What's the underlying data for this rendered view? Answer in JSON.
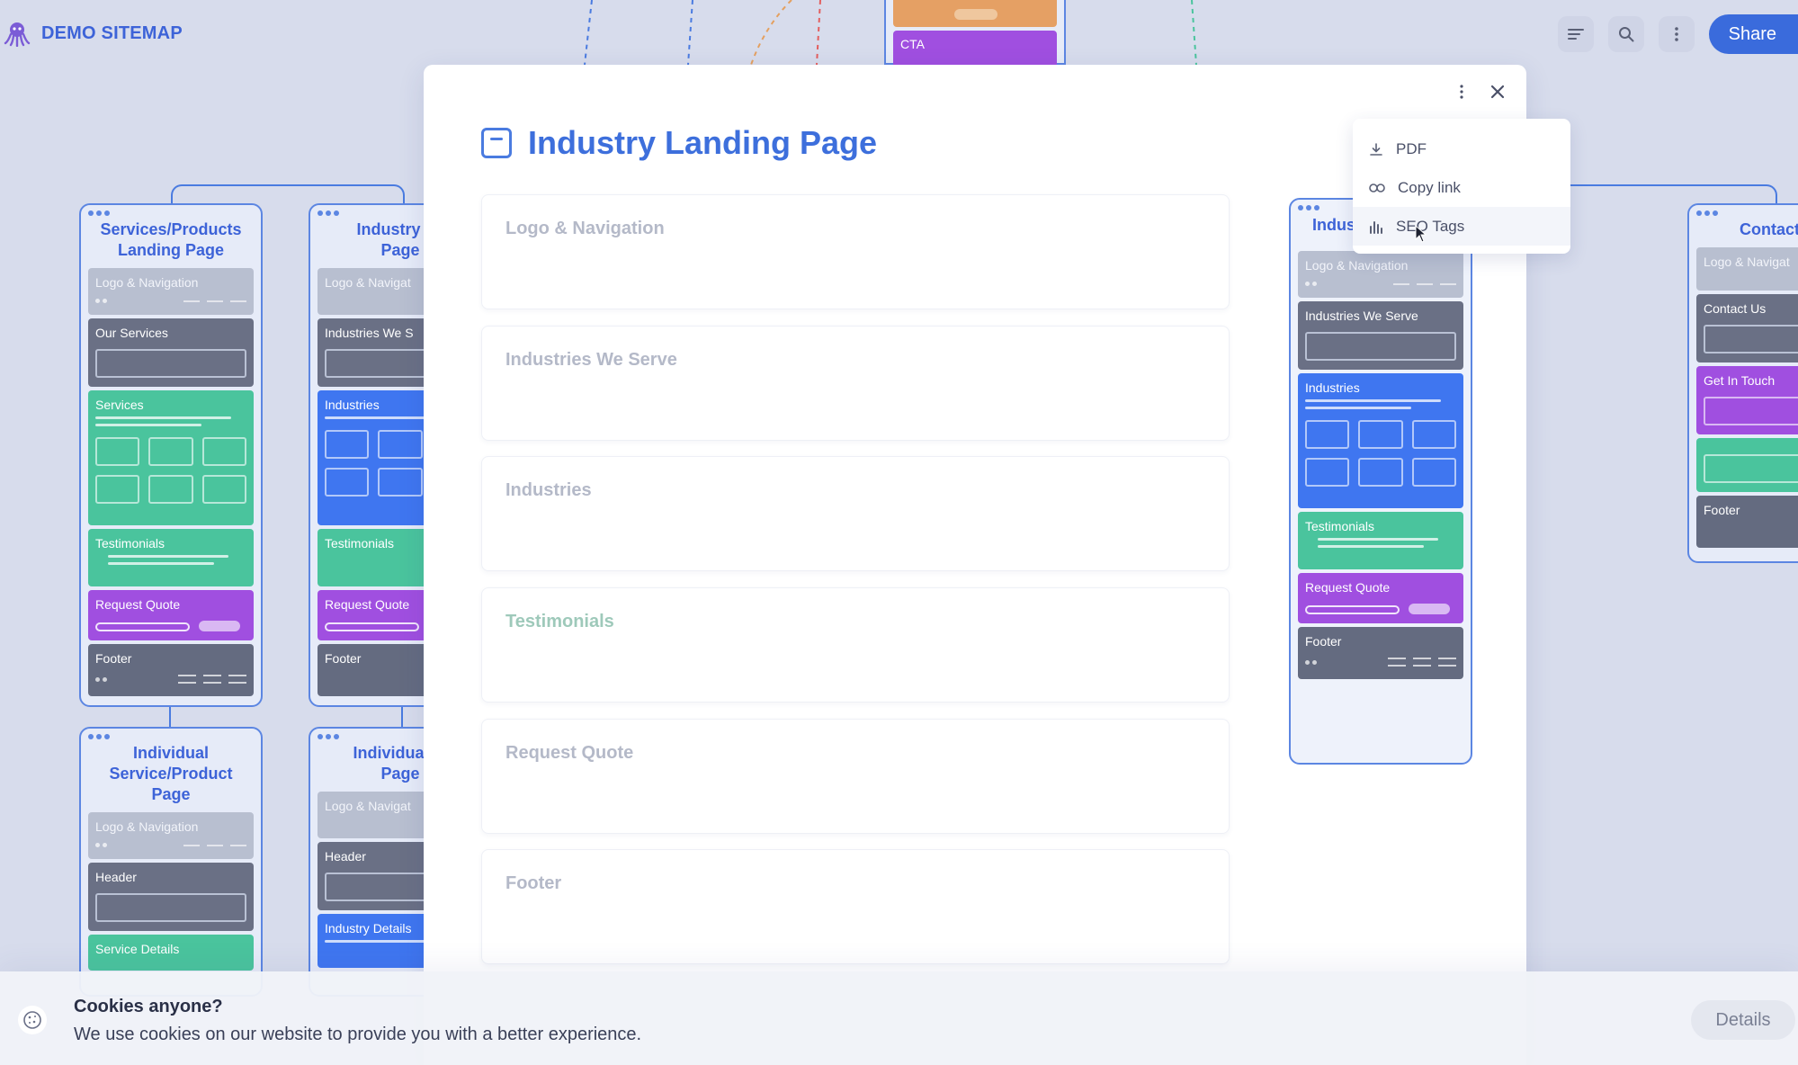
{
  "app": {
    "brand": "DEMO SITEMAP",
    "share_label": "Share"
  },
  "colors": {
    "accent": "#3d63d8",
    "green": "#4ac49d",
    "blue": "#3f76f0",
    "purple": "#a04fe0",
    "dark": "#6a7085",
    "orange": "#e5a064"
  },
  "top_card": {
    "cta_label": "CTA"
  },
  "cards": {
    "services": {
      "title": "Services/Products Landing Page",
      "sections": [
        "Logo & Navigation",
        "Our Services",
        "Services",
        "Testimonials",
        "Request Quote",
        "Footer"
      ]
    },
    "industry": {
      "title": "Industry La... Page",
      "title_line1": "Industry La",
      "title_line2": "Page",
      "sections": [
        "Logo & Navigat",
        "Industries We S",
        "Industries",
        "Testimonials",
        "Request Quote",
        "Footer"
      ]
    },
    "individual_service": {
      "title": "Individual Service/Product Page",
      "sections": [
        "Logo & Navigation",
        "Header",
        "Service Details"
      ]
    },
    "individual_industry": {
      "title_line1": "Individual In",
      "title_line2": "Page",
      "sections": [
        "Logo & Navigat",
        "Header",
        "Industry Details"
      ]
    },
    "contact": {
      "title": "Contact",
      "sections": [
        "Logo & Navigat",
        "Contact Us",
        "Get In Touch",
        "Footer"
      ]
    }
  },
  "modal": {
    "title": "Industry Landing Page",
    "sections": [
      "Logo & Navigation",
      "Industries We Serve",
      "Industries",
      "Testimonials",
      "Request Quote",
      "Footer"
    ],
    "preview": {
      "title": "Indus",
      "sections": [
        "Logo & Navigation",
        "Industries We Serve",
        "Industries",
        "Testimonials",
        "Request Quote",
        "Footer"
      ]
    },
    "menu": [
      {
        "label": "PDF",
        "icon": "download-icon"
      },
      {
        "label": "Copy link",
        "icon": "link-icon"
      },
      {
        "label": "SEO Tags",
        "icon": "bar-chart-icon"
      }
    ]
  },
  "cookie": {
    "title": "Cookies anyone?",
    "text": "We use cookies on our website to provide you with a better experience.",
    "details_label": "Details"
  }
}
